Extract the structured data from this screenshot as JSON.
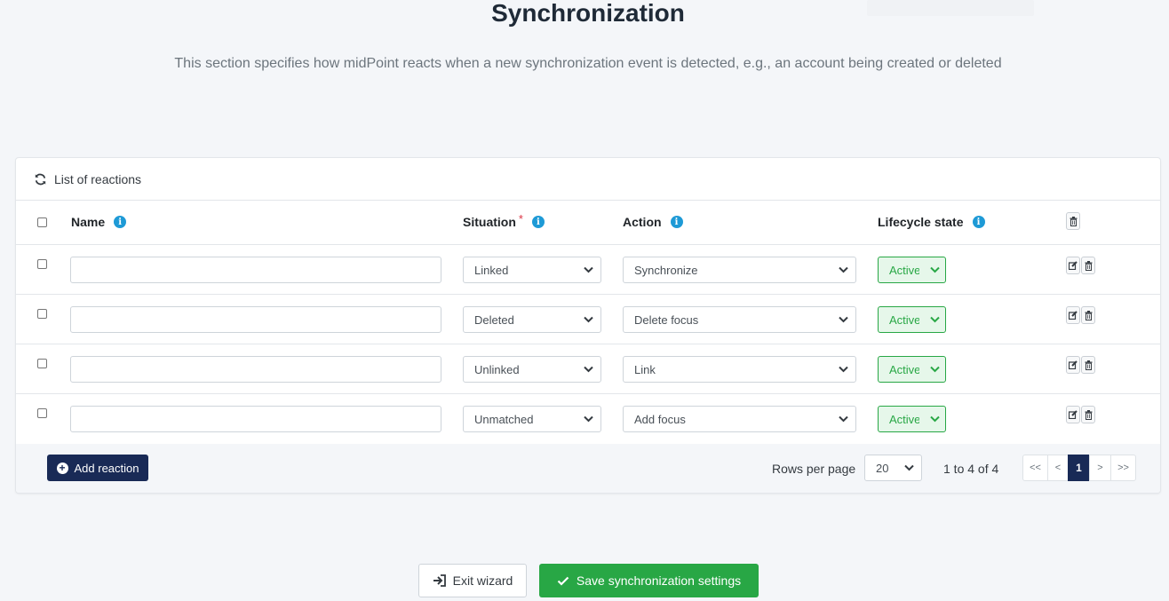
{
  "header": {
    "title": "Synchronization",
    "description": "This section specifies how midPoint reacts when a new synchronization event is detected, e.g., an account being created or deleted"
  },
  "table": {
    "title": "List of reactions",
    "columns": {
      "name": "Name",
      "situation": "Situation",
      "situation_required": "*",
      "action": "Action",
      "lifecycle": "Lifecycle state"
    },
    "rows": [
      {
        "name": "",
        "situation": "Linked",
        "action": "Synchronize",
        "lifecycle": "Active"
      },
      {
        "name": "",
        "situation": "Deleted",
        "action": "Delete focus",
        "lifecycle": "Active"
      },
      {
        "name": "",
        "situation": "Unlinked",
        "action": "Link",
        "lifecycle": "Active"
      },
      {
        "name": "",
        "situation": "Unmatched",
        "action": "Add focus",
        "lifecycle": "Active"
      }
    ]
  },
  "footer": {
    "add_label": "Add reaction",
    "rows_per_page_label": "Rows per page",
    "rows_per_page_value": "20",
    "range_text": "1 to 4 of 4",
    "pager": {
      "first": "<<",
      "prev": "<",
      "current": "1",
      "next": ">",
      "last": ">>"
    }
  },
  "actions": {
    "exit_label": "Exit wizard",
    "save_label": "Save synchronization settings"
  },
  "colors": {
    "primary": "#192a56",
    "success": "#28a745",
    "info": "#1e9ad6",
    "required": "#dc3545"
  },
  "icons": {
    "refresh": "refresh-icon",
    "info": "info-icon",
    "edit": "edit-icon",
    "trash": "trash-icon",
    "chevron": "chevron-down-icon",
    "plus": "plus-circle-icon",
    "exit": "sign-in-icon",
    "check": "check-icon"
  }
}
